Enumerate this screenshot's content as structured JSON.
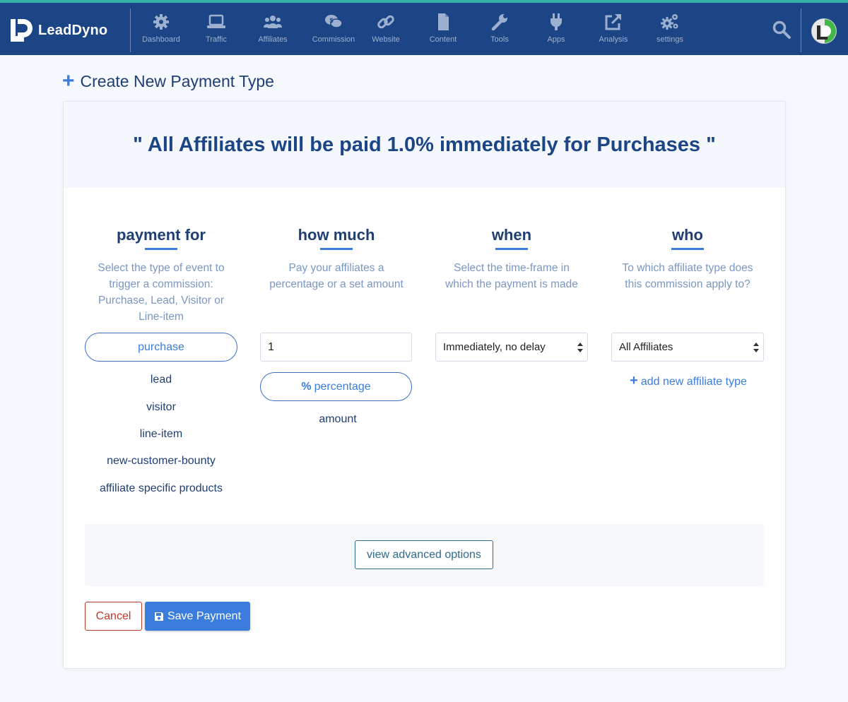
{
  "colors": {
    "nav_bg": "#1c4586",
    "accent": "#3b7ddd",
    "danger": "#c0392b",
    "teal_stripe": "#33b2a8"
  },
  "brand": {
    "name": "LeadDyno",
    "logo_icon": "leaddyno-logo-icon"
  },
  "nav": {
    "items": [
      {
        "label": "Dashboard",
        "icon": "gear-icon"
      },
      {
        "label": "Traffic",
        "icon": "laptop-icon"
      },
      {
        "label": "Affiliates",
        "icon": "users-icon"
      },
      {
        "label": "Commission",
        "icon": "money-chat-icon"
      },
      {
        "label": "Website",
        "icon": "link-icon"
      },
      {
        "label": "Content",
        "icon": "document-icon"
      },
      {
        "label": "Tools",
        "icon": "wrench-icon"
      },
      {
        "label": "Apps",
        "icon": "plug-icon"
      },
      {
        "label": "Analysis",
        "icon": "external-link-icon"
      },
      {
        "label": "settings",
        "icon": "gears-icon"
      }
    ],
    "search_icon": "search-icon",
    "avatar_icon": "user-avatar"
  },
  "page": {
    "title": "Create New Payment Type",
    "title_icon": "plus-icon"
  },
  "summary": "\" All Affiliates will be paid 1.0% immediately for Purchases \"",
  "columns": {
    "payment_for": {
      "title": "payment for",
      "description": "Select the type of event to trigger a commission: Purchase, Lead, Visitor or Line-item",
      "selected": "purchase",
      "options": [
        "lead",
        "visitor",
        "line-item",
        "new-customer-bounty",
        "affiliate specific products"
      ]
    },
    "how_much": {
      "title": "how much",
      "description": "Pay your affiliates a percentage or a set amount",
      "value": "1",
      "selected": "percentage",
      "selected_icon": "percent-icon",
      "options": [
        "amount"
      ]
    },
    "when": {
      "title": "when",
      "description": "Select the time-frame in which the payment is made",
      "selected": "Immediately, no delay"
    },
    "who": {
      "title": "who",
      "description": "To which affiliate type does this commission apply to?",
      "selected": "All Affiliates",
      "add_link": "add new affiliate type"
    }
  },
  "actions": {
    "advanced": "view advanced options",
    "cancel": "Cancel",
    "save": "Save Payment",
    "save_icon": "floppy-disk-icon"
  }
}
